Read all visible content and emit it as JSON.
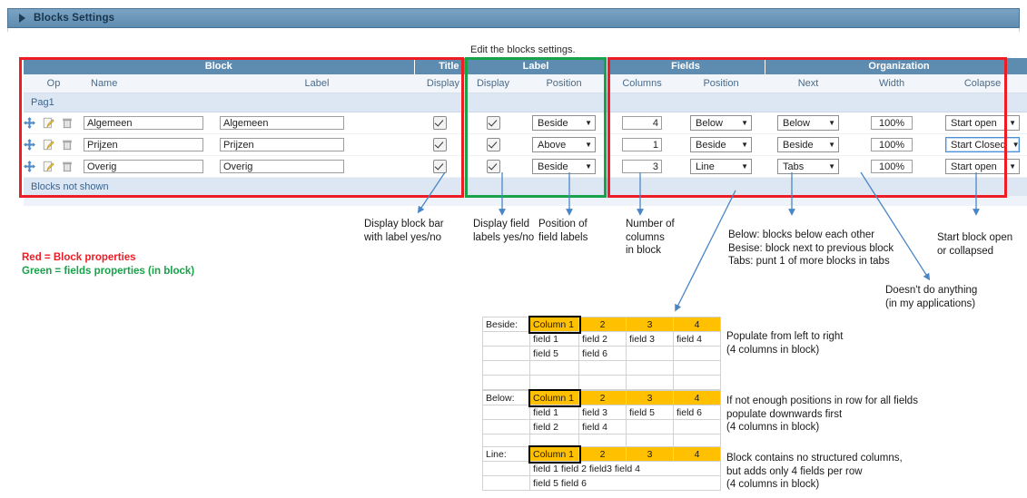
{
  "window": {
    "title": "Blocks Settings",
    "expander_icon": "triangle-right-icon"
  },
  "caption": "Edit the blocks settings.",
  "table": {
    "group_headers": [
      {
        "label": "Block",
        "span": 3
      },
      {
        "label": "Title",
        "span": 1
      },
      {
        "label": "Label",
        "span": 2
      },
      {
        "label": "Fields",
        "span": 2
      },
      {
        "label": "Organization",
        "span": 3
      }
    ],
    "column_headers": [
      "Op",
      "Name",
      "Label",
      "Display",
      "Display",
      "Position",
      "Columns",
      "Position",
      "Next",
      "Width",
      "Colapse"
    ],
    "section_label": "Pag1",
    "footer_label": "Blocks not shown",
    "row_icons": [
      "move-icon",
      "edit-icon",
      "delete-icon"
    ],
    "rows": [
      {
        "name": "Algemeen",
        "label": "Algemeen",
        "title_display": true,
        "label_display": true,
        "label_position": "Beside",
        "columns": "4",
        "field_position": "Below",
        "next": "Below",
        "width": "100%",
        "collapse": "Start open",
        "collapse_focused": false
      },
      {
        "name": "Prijzen",
        "label": "Prijzen",
        "title_display": true,
        "label_display": true,
        "label_position": "Above",
        "columns": "1",
        "field_position": "Beside",
        "next": "Beside",
        "width": "100%",
        "collapse": "Start Closed",
        "collapse_focused": true
      },
      {
        "name": "Overig",
        "label": "Overig",
        "title_display": true,
        "label_display": true,
        "label_position": "Beside",
        "columns": "3",
        "field_position": "Line",
        "next": "Tabs",
        "width": "100%",
        "collapse": "Start open",
        "collapse_focused": false
      }
    ]
  },
  "highlight_boxes": {
    "red_color": "#ee1c25",
    "green_color": "#18a24a"
  },
  "legend": {
    "red": "Red = Block properties",
    "green": "Green = fields properties (in block)"
  },
  "annotations": [
    {
      "id": "display-block-bar",
      "text": "Display block bar\nwith label yes/no"
    },
    {
      "id": "display-field-labels",
      "text": "Display field\nlabels yes/no"
    },
    {
      "id": "position-field-labels",
      "text": "Position of\nfield labels"
    },
    {
      "id": "number-of-columns",
      "text": "Number of\ncolumns\nin block"
    },
    {
      "id": "next-explanation",
      "text": "Below: blocks below each other\nBesise: block next to previous block\nTabs: punt 1 of more blocks in tabs"
    },
    {
      "id": "width-explanation",
      "text": "Doesn't do anything\n(in my applications)"
    },
    {
      "id": "collapse-explanation",
      "text": "Start block open\nor collapsed"
    }
  ],
  "examples": [
    {
      "name": "Beside",
      "row_label": "Beside:",
      "header": [
        "Column 1",
        "2",
        "3",
        "4"
      ],
      "body": [
        [
          "field 1",
          "field 2",
          "field 3",
          "field 4"
        ],
        [
          "field 5",
          "field 6",
          "",
          ""
        ]
      ],
      "extra_blank_rows": 2,
      "note": "Populate from left to right\n(4 columns in block)"
    },
    {
      "name": "Below",
      "row_label": "Below:",
      "header": [
        "Column 1",
        "2",
        "3",
        "4"
      ],
      "body": [
        [
          "field 1",
          "field 3",
          "field 5",
          "field 6"
        ],
        [
          "field 2",
          "field 4",
          "",
          ""
        ]
      ],
      "extra_blank_rows": 1,
      "note": "If not enough positions in row for all fields\npopulate downwards first\n(4 columns in block)"
    },
    {
      "name": "Line",
      "row_label": "Line:",
      "header": [
        "Column 1",
        "2",
        "3",
        "4"
      ],
      "merged_body": [
        "field 1 field 2 field3 field 4",
        "field 5 field 6"
      ],
      "note": "Block contains no structured columns,\nbut adds only 4 fields per row\n(4 columns in block)"
    }
  ],
  "colors": {
    "header_blue": "#5e8cb0",
    "section_blue": "#dde7f3",
    "excel_header": "#ffc000"
  }
}
